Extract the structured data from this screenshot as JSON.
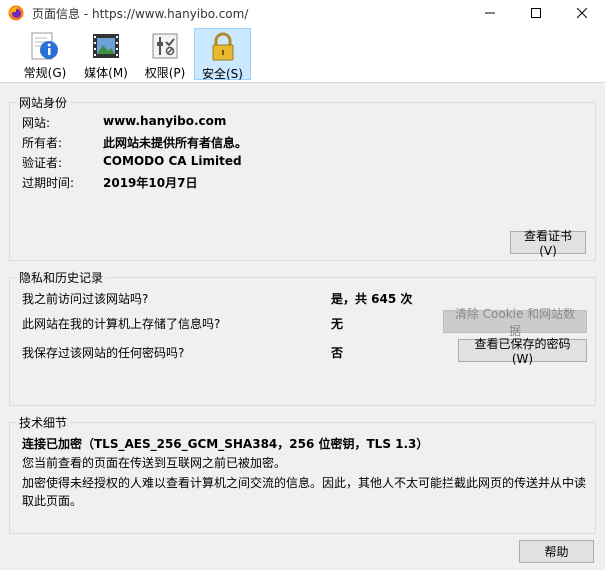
{
  "window": {
    "title": "页面信息 - https://www.hanyibo.com/"
  },
  "toolbar": {
    "items": [
      {
        "label": "常规(G)",
        "icon": "info-icon"
      },
      {
        "label": "媒体(M)",
        "icon": "media-icon"
      },
      {
        "label": "权限(P)",
        "icon": "permissions-icon"
      },
      {
        "label": "安全(S)",
        "icon": "lock-icon"
      }
    ]
  },
  "identity": {
    "title": "网站身份",
    "website_label": "网站:",
    "website_value": "www.hanyibo.com",
    "owner_label": "所有者:",
    "owner_value": "此网站未提供所有者信息。",
    "verifier_label": "验证者:",
    "verifier_value": "COMODO CA Limited",
    "expiry_label": "过期时间:",
    "expiry_value": "2019年10月7日",
    "view_cert_button": "查看证书(V)"
  },
  "privacy": {
    "title": "隐私和历史记录",
    "q1": "我之前访问过该网站吗?",
    "a1": "是，共 645 次",
    "q2": "此网站在我的计算机上存储了信息吗?",
    "a2": "无",
    "clear_button": "清除 Cookie 和网站数据",
    "q3": "我保存过该网站的任何密码吗?",
    "a3": "否",
    "saved_pw_button": "查看已保存的密码(W)"
  },
  "tech": {
    "title": "技术细节",
    "connection": "连接已加密（TLS_AES_256_GCM_SHA384，256 位密钥，TLS 1.3）",
    "line1": "您当前查看的页面在传送到互联网之前已被加密。",
    "line2": "加密使得未经授权的人难以查看计算机之间交流的信息。因此，其他人不太可能拦截此网页的传送并从中读取此页面。"
  },
  "footer": {
    "help_button": "帮助"
  }
}
